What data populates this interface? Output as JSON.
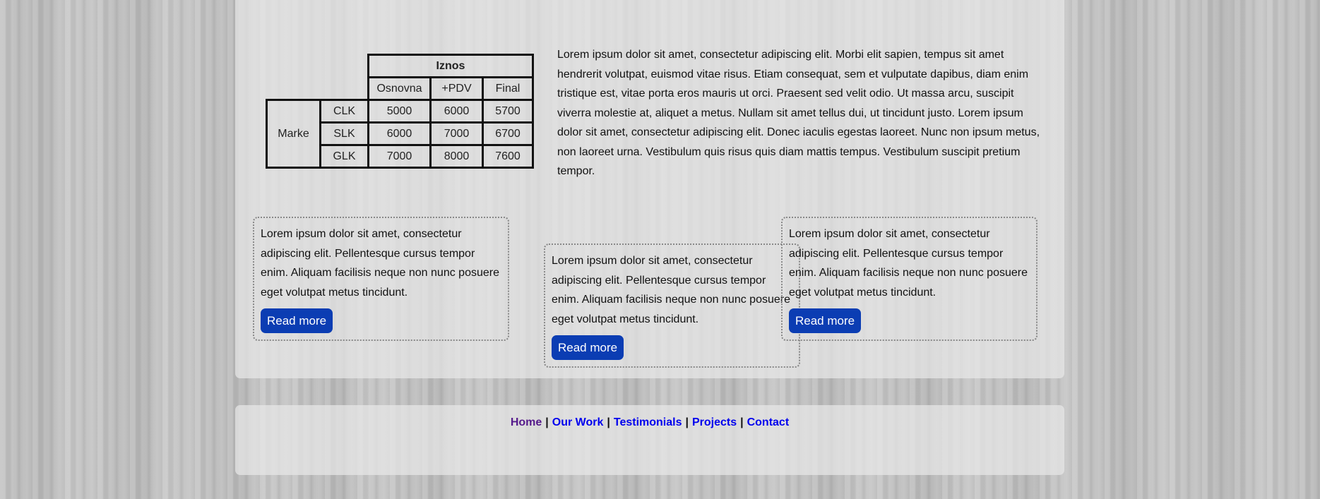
{
  "table": {
    "group_header": "Iznos",
    "sub_headers": [
      "Osnovna",
      "+PDV",
      "Final"
    ],
    "row_group_label": "Marke",
    "rows": [
      {
        "label": "CLK",
        "values": [
          "5000",
          "6000",
          "5700"
        ]
      },
      {
        "label": "SLK",
        "values": [
          "6000",
          "7000",
          "6700"
        ]
      },
      {
        "label": "GLK",
        "values": [
          "7000",
          "8000",
          "7600"
        ]
      }
    ]
  },
  "intro": {
    "text": "Lorem ipsum dolor sit amet, consectetur adipiscing elit. Morbi elit sapien, tempus sit amet hendrerit volutpat, euismod vitae risus. Etiam consequat, sem et vulputate dapibus, diam enim tristique est, vitae porta eros mauris ut orci. Praesent sed velit odio. Ut massa arcu, suscipit viverra molestie at, aliquet a metus. Nullam sit amet tellus dui, ut tincidunt justo. Lorem ipsum dolor sit amet, consectetur adipiscing elit. Donec iaculis egestas laoreet. Nunc non ipsum metus, non laoreet urna. Vestibulum quis risus quis diam mattis tempus. Vestibulum suscipit pretium tempor."
  },
  "cards": [
    {
      "text": "Lorem ipsum dolor sit amet, consectetur adipiscing elit. Pellentesque cursus tempor enim. Aliquam facilisis neque non nunc posuere eget volutpat metus tincidunt.",
      "button": "Read more"
    },
    {
      "text": "Lorem ipsum dolor sit amet, consectetur adipiscing elit. Pellentesque cursus tempor enim. Aliquam facilisis neque non nunc posuere eget volutpat metus tincidunt.",
      "button": "Read more"
    },
    {
      "text": "Lorem ipsum dolor sit amet, consectetur adipiscing elit. Pellentesque cursus tempor enim. Aliquam facilisis neque non nunc posuere eget volutpat metus tincidunt.",
      "button": "Read more"
    }
  ],
  "footer": {
    "links": [
      "Home",
      "Our Work",
      "Testimonials",
      "Projects",
      "Contact"
    ],
    "separator": "|"
  },
  "colors": {
    "button_bg": "#0b3db3",
    "link": "#0000ee",
    "visited_link": "#551a8b"
  }
}
